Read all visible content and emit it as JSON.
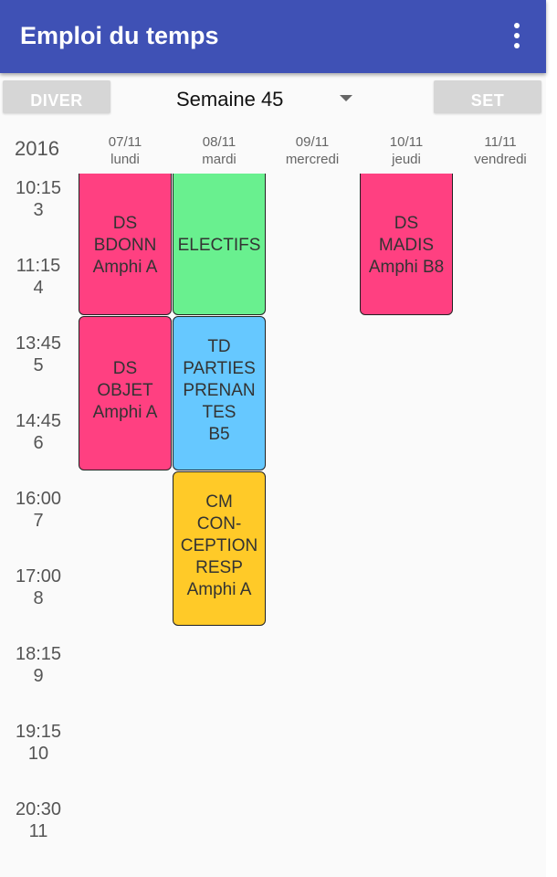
{
  "app": {
    "title": "Emploi du temps",
    "menu_icon": "more-vert-icon",
    "accent": "#3f51b5"
  },
  "toolbar": {
    "prev_label": "DIVER",
    "next_label": "SET",
    "week_label": "Semaine 45"
  },
  "year": "2016",
  "days": [
    {
      "date": "07/11",
      "name": "lundi"
    },
    {
      "date": "08/11",
      "name": "mardi"
    },
    {
      "date": "09/11",
      "name": "mercredi"
    },
    {
      "date": "10/11",
      "name": "jeudi"
    },
    {
      "date": "11/11",
      "name": "vendredi"
    }
  ],
  "slots": [
    {
      "time": "10:15",
      "num": "3"
    },
    {
      "time": "11:15",
      "num": "4"
    },
    {
      "time": "13:45",
      "num": "5"
    },
    {
      "time": "14:45",
      "num": "6"
    },
    {
      "time": "16:00",
      "num": "7"
    },
    {
      "time": "17:00",
      "num": "8"
    },
    {
      "time": "18:15",
      "num": "9"
    },
    {
      "time": "19:15",
      "num": "10"
    },
    {
      "time": "20:30",
      "num": "11"
    }
  ],
  "events": [
    {
      "day": 0,
      "start": 0,
      "span": 2,
      "color": "#ff4081",
      "lines": [
        "DS",
        "BDONN",
        "Amphi A"
      ]
    },
    {
      "day": 1,
      "start": 0,
      "span": 2,
      "color": "#69f08f",
      "lines": [
        "ELECTIFS"
      ]
    },
    {
      "day": 3,
      "start": 0,
      "span": 2,
      "color": "#ff4081",
      "lines": [
        "DS",
        "MADIS",
        "Amphi B8"
      ]
    },
    {
      "day": 0,
      "start": 2,
      "span": 2,
      "color": "#ff4081",
      "lines": [
        "DS",
        "OBJET",
        "Amphi A"
      ]
    },
    {
      "day": 1,
      "start": 2,
      "span": 2,
      "color": "#66c8ff",
      "lines": [
        "TD",
        "PARTIES",
        "PRENAN",
        "TES",
        "B5"
      ]
    },
    {
      "day": 1,
      "start": 4,
      "span": 2,
      "color": "#ffca28",
      "lines": [
        "CM",
        "CON-",
        "CEPTION",
        "RESP",
        "Amphi A"
      ]
    }
  ]
}
